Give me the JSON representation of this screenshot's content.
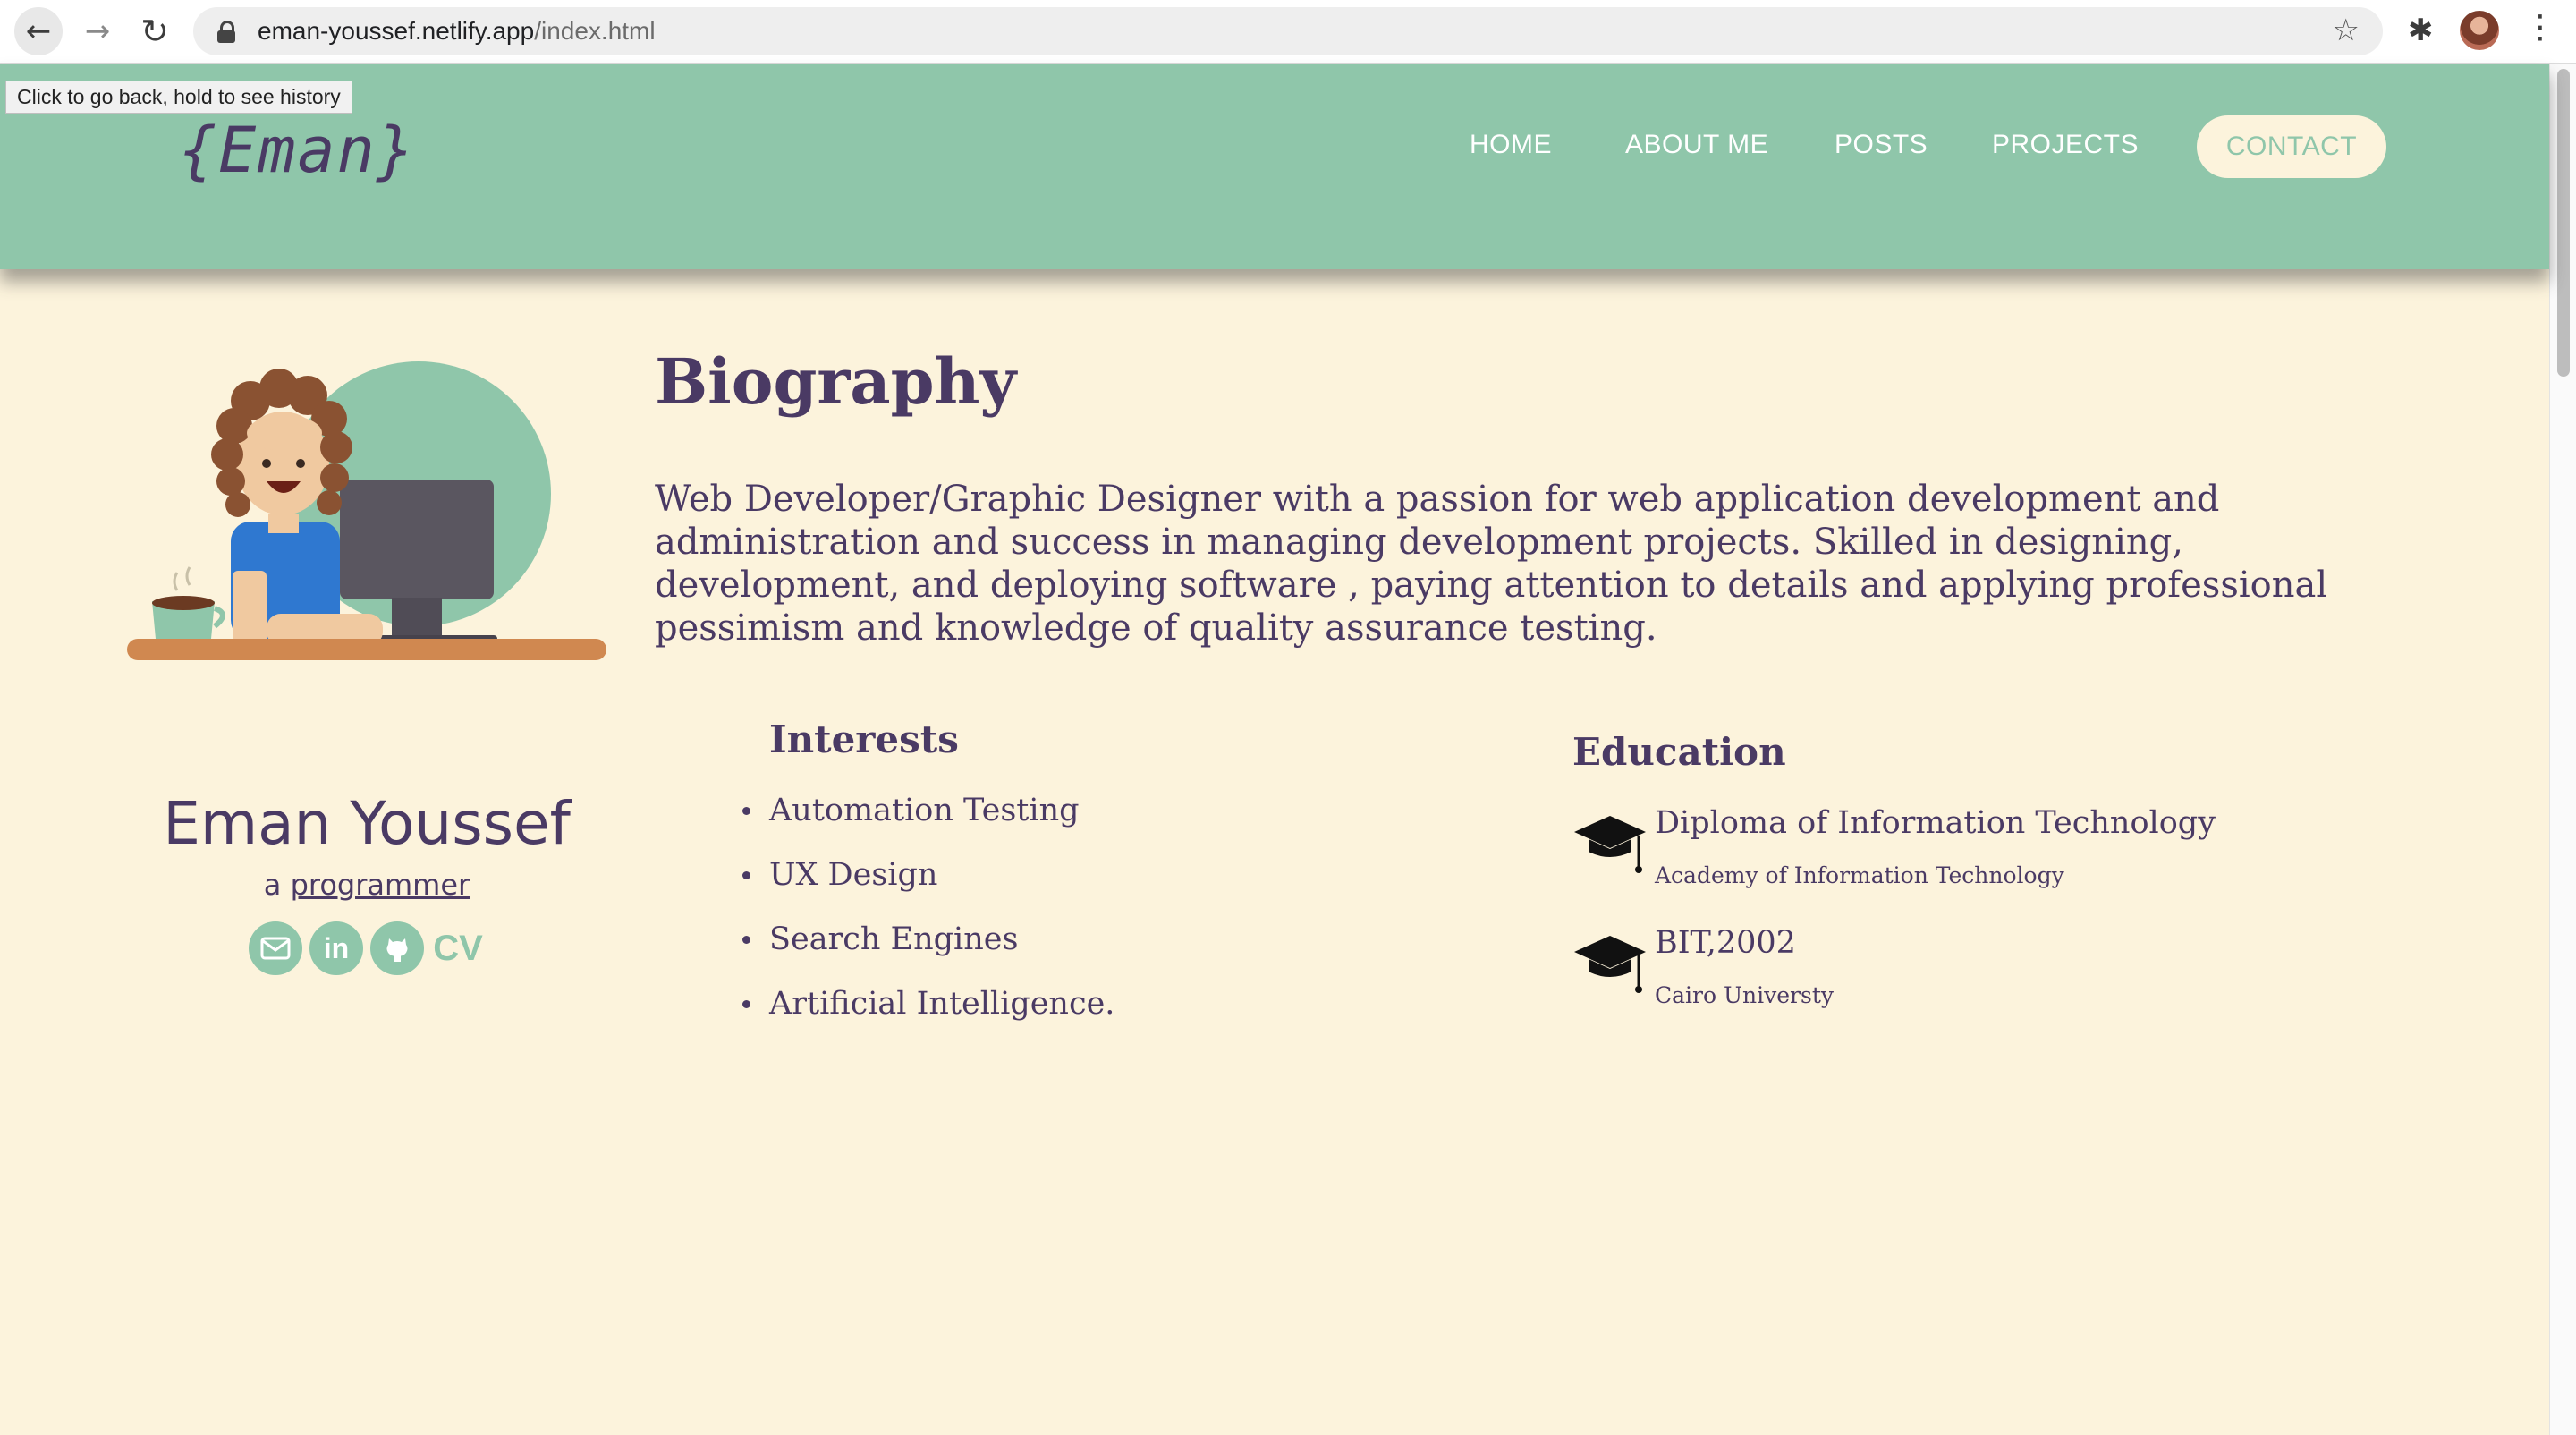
{
  "browser": {
    "url_host": "eman-youssef.netlify.app",
    "url_path": "/index.html",
    "tooltip": "Click to go back, hold to see history",
    "icons": [
      "back-arrow-icon",
      "forward-arrow-icon",
      "reload-icon",
      "lock-icon",
      "star-icon",
      "puzzle-extension-icon",
      "profile-avatar",
      "more-menu-icon"
    ]
  },
  "header": {
    "logo": "{Eman}",
    "nav": [
      "HOME",
      "ABOUT ME",
      "POSTS",
      "PROJECTS",
      "CONTACT"
    ]
  },
  "bio": {
    "title": "Biography",
    "text": "Web Developer/Graphic Designer with a passion for web application development and administration and success in managing development projects. Skilled in designing, development, and deploying software , paying attention to details and applying professional pessimism and knowledge of quality assurance testing."
  },
  "profile": {
    "name": "Eman Youssef",
    "role_prefix": "a ",
    "role_word": "programmer",
    "socials": [
      "mail-icon",
      "linkedin-icon",
      "github-icon"
    ],
    "cv_label": "CV"
  },
  "interests": {
    "title": "Interests",
    "items": [
      "Automation Testing",
      "UX Design",
      "Search Engines",
      "Artificial Intelligence."
    ]
  },
  "education": {
    "title": "Education",
    "items": [
      {
        "degree": "Diploma of Information Technology",
        "school": "Academy of Information Technology"
      },
      {
        "degree": "BIT,2002",
        "school": "Cairo Universty"
      }
    ]
  },
  "colors": {
    "header_green": "#8fc6aa",
    "page_background": "#fcf3dc",
    "text_purple": "#4a3a64",
    "desk_orange": "#d08850"
  }
}
